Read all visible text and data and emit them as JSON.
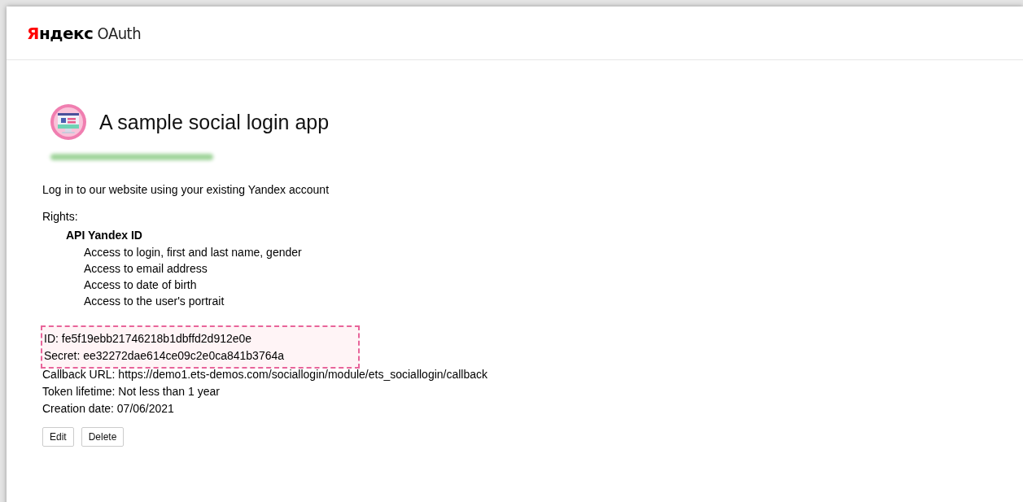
{
  "header": {
    "logo": {
      "accent": "Я",
      "brand": "ндекс",
      "product": "OAuth"
    }
  },
  "app": {
    "title": "A sample social login app",
    "description": "Log in to our website using your existing Yandex account",
    "rights_label": "Rights:",
    "rights": [
      {
        "group": "API Yandex ID",
        "items": [
          "Access to login, first and last name, gender",
          "Access to email address",
          "Access to date of birth",
          "Access to the user's portrait"
        ]
      }
    ],
    "highlighted_fields": [
      {
        "label": "ID:",
        "value": "fe5f19ebb21746218b1dbffd2d912e0e"
      },
      {
        "label": "Secret:",
        "value": "ee32272dae614ce09c2e0ca841b3764a"
      }
    ],
    "fields": [
      {
        "label": "Callback URL:",
        "value": "https://demo1.ets-demos.com/sociallogin/module/ets_sociallogin/callback"
      },
      {
        "label": "Token lifetime:",
        "value": "Not less than 1 year"
      },
      {
        "label": "Creation date:",
        "value": "07/06/2021"
      }
    ],
    "buttons": [
      "Edit",
      "Delete"
    ]
  }
}
